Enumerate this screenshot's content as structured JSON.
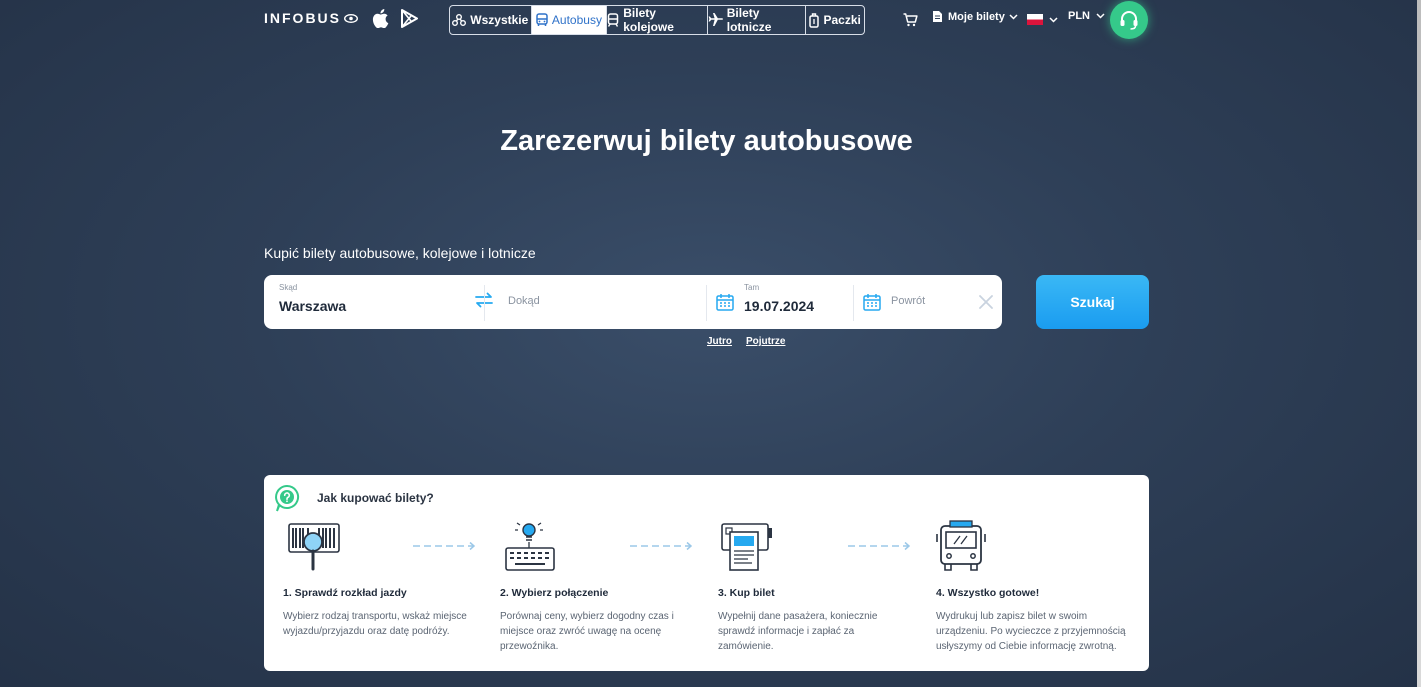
{
  "header": {
    "logo": "INFOBUS",
    "tabs": [
      {
        "label": "Wszystkie",
        "icon": "routes-icon",
        "active": false
      },
      {
        "label": "Autobusy",
        "icon": "bus-icon",
        "active": true
      },
      {
        "label": "Bilety kolejowe",
        "icon": "train-icon",
        "active": false
      },
      {
        "label": "Bilety lotnicze",
        "icon": "plane-icon",
        "active": false
      },
      {
        "label": "Paczki",
        "icon": "package-icon",
        "active": false
      }
    ],
    "my_tickets": "Moje bilety",
    "currency": "PLN"
  },
  "hero": {
    "title": "Zarezerwuj bilety autobusowe",
    "subtitle": "Kupić bilety autobusowe, kolejowe i lotnicze"
  },
  "search": {
    "from_label": "Skąd",
    "from_value": "Warszawa",
    "to_placeholder": "Dokąd",
    "date_label": "Tam",
    "date_value": "19.07.2024",
    "return_placeholder": "Powrót",
    "button": "Szukaj",
    "quick_tomorrow": "Jutro",
    "quick_day_after": "Pojutrze"
  },
  "howto": {
    "title": "Jak kupować bilety?",
    "steps": [
      {
        "title": "1. Sprawdź rozkład jazdy",
        "text": "Wybierz rodzaj transportu, wskaż miejsce wyjazdu/przyjazdu oraz datę podróży."
      },
      {
        "title": "2. Wybierz połączenie",
        "text": "Porównaj ceny, wybierz dogodny czas i miejsce oraz zwróć uwagę na ocenę przewoźnika."
      },
      {
        "title": "3. Kup bilet",
        "text": "Wypełnij dane pasażera, koniecznie sprawdź informacje i zapłać za zamówienie."
      },
      {
        "title": "4. Wszystko gotowe!",
        "text": "Wydrukuj lub zapisz bilet w swoim urządzeniu. Po wycieczce z przyjemnością usłyszymy od Ciebie informację zwrotną."
      }
    ]
  },
  "colors": {
    "accent_blue": "#1a9cf0",
    "support_green": "#35c98a",
    "active_tab_text": "#2f72c9"
  }
}
